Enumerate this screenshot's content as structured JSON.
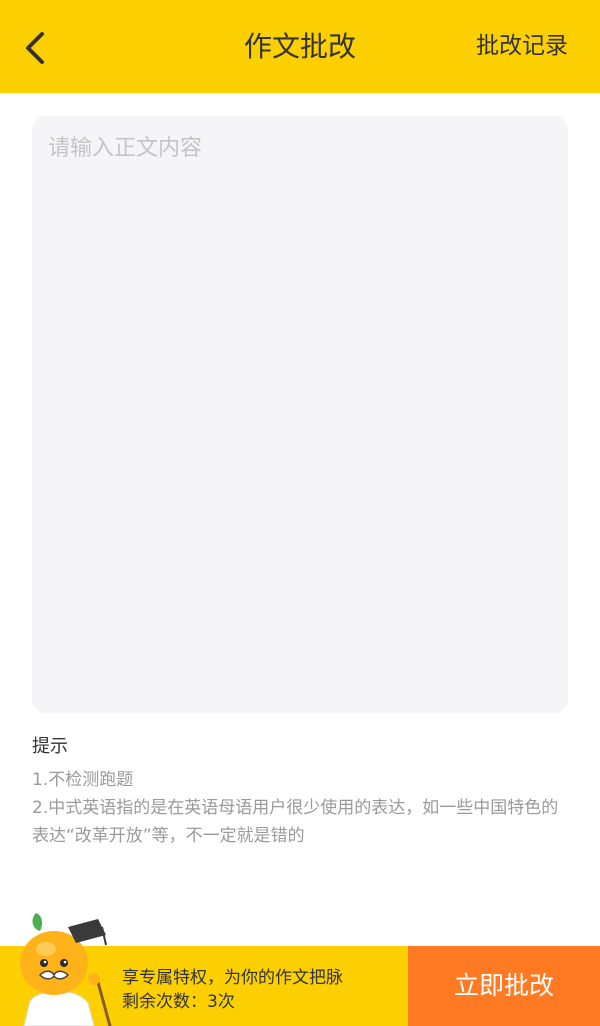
{
  "header": {
    "title": "作文批改",
    "back_icon": "chevron-left-icon",
    "records_label": "批改记录",
    "background": "#fcd000"
  },
  "editor": {
    "placeholder": "请输入正文内容",
    "value": ""
  },
  "tips": {
    "title": "提示",
    "lines": [
      "1.不检测跑题",
      "2.中式英语指的是在英语母语用户很少使用的表达，如一些中国特色的表达“改革开放”等，不一定就是错的"
    ]
  },
  "footer": {
    "mascot_icon": "orange-mascot-icon",
    "promo_line1": "享专属特权，为你的作文把脉",
    "promo_line2": "剩余次数：3次",
    "submit_label": "立即批改",
    "colors": {
      "bar": "#fcd000",
      "submit": "#ff7a22"
    }
  }
}
